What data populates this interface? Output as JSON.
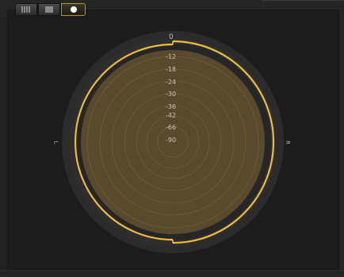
{
  "toolbar": {
    "modes": [
      {
        "name": "bars",
        "icon": "vertical-bars-icon",
        "active": false
      },
      {
        "name": "lines",
        "icon": "horizontal-lines-icon",
        "active": false
      },
      {
        "name": "circle",
        "icon": "circle-dot-icon",
        "active": true
      }
    ]
  },
  "scope": {
    "top_label": "0",
    "left_label": "L",
    "right_label": "R",
    "scale": [
      "-12",
      "-18",
      "-24",
      "-30",
      "-36",
      "-42",
      "-66",
      "-90"
    ],
    "colors": {
      "accent": "#f0bb3a",
      "fill": "#5c4b2c",
      "ring": "#2a2a2a",
      "halo": "#303030",
      "gridline": "#7a6a4a"
    }
  }
}
